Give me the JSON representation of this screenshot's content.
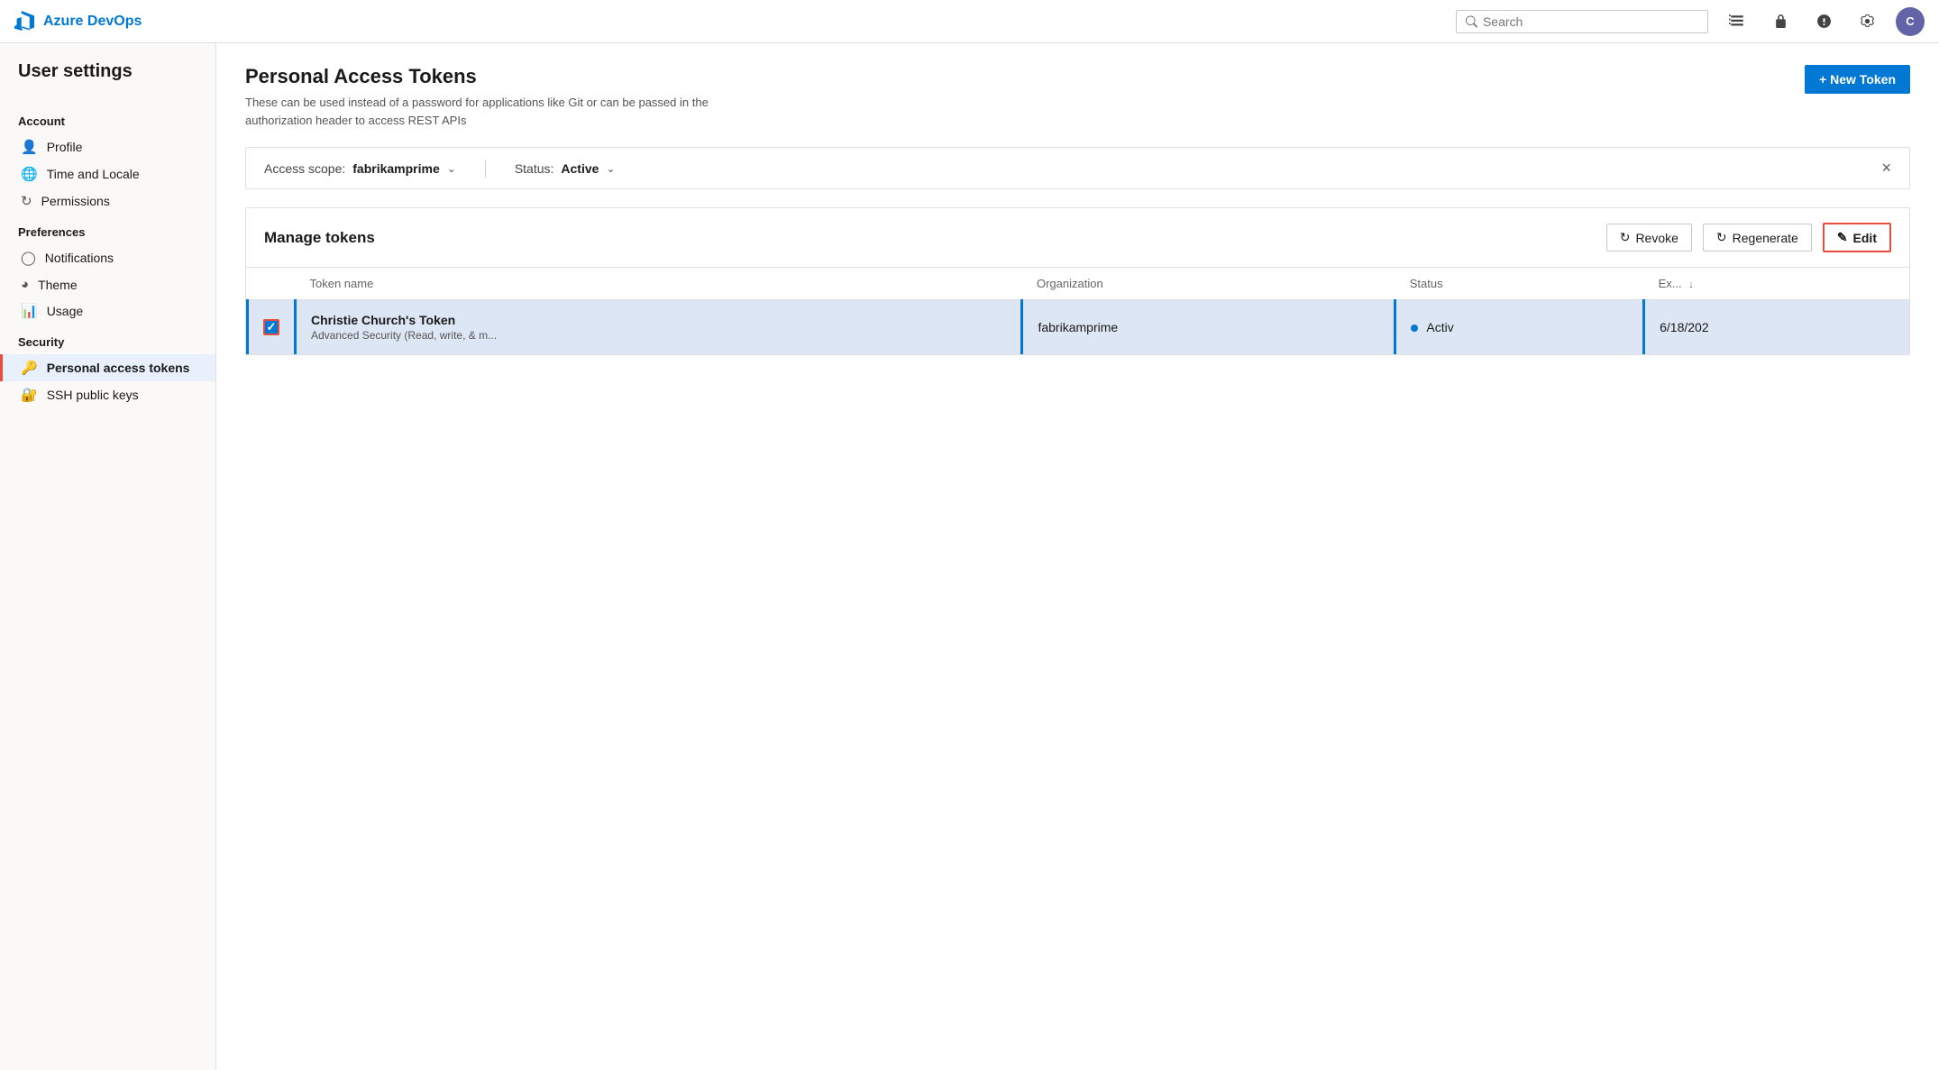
{
  "app": {
    "name": "Azure DevOps",
    "logo_color": "#0078d4"
  },
  "nav": {
    "search_placeholder": "Search",
    "icons": [
      "list-icon",
      "lock-icon",
      "help-icon",
      "settings-icon"
    ],
    "avatar_initials": "C"
  },
  "sidebar": {
    "title": "User settings",
    "sections": [
      {
        "label": "Account",
        "items": [
          {
            "id": "profile",
            "label": "Profile",
            "icon": "👤"
          },
          {
            "id": "time-locale",
            "label": "Time and Locale",
            "icon": "🌐"
          },
          {
            "id": "permissions",
            "label": "Permissions",
            "icon": "🔄"
          }
        ]
      },
      {
        "label": "Preferences",
        "items": [
          {
            "id": "notifications",
            "label": "Notifications",
            "icon": "🔔"
          },
          {
            "id": "theme",
            "label": "Theme",
            "icon": "🎨"
          },
          {
            "id": "usage",
            "label": "Usage",
            "icon": "📊"
          }
        ]
      },
      {
        "label": "Security",
        "items": [
          {
            "id": "personal-access-tokens",
            "label": "Personal access tokens",
            "icon": "🔑",
            "active": true
          },
          {
            "id": "ssh-public-keys",
            "label": "SSH public keys",
            "icon": "🔒"
          }
        ]
      }
    ]
  },
  "main": {
    "page_title": "Personal Access Tokens",
    "page_description": "These can be used instead of a password for applications like Git or can be passed in the authorization header to access REST APIs",
    "new_token_label": "+ New Token",
    "filter_bar": {
      "scope_label": "Access scope:",
      "scope_value": "fabrikamprime",
      "status_label": "Status:",
      "status_value": "Active",
      "close_label": "×"
    },
    "manage_section": {
      "title": "Manage tokens",
      "revoke_label": "Revoke",
      "regenerate_label": "Regenerate",
      "edit_label": "Edit",
      "table": {
        "columns": [
          {
            "id": "checkbox",
            "label": ""
          },
          {
            "id": "token-name",
            "label": "Token name"
          },
          {
            "id": "organization",
            "label": "Organization"
          },
          {
            "id": "status",
            "label": "Status"
          },
          {
            "id": "expiry",
            "label": "Ex..."
          }
        ],
        "rows": [
          {
            "id": "row1",
            "name": "Christie Church's Token",
            "description": "Advanced Security (Read, write, & m...",
            "organization": "fabrikamprime",
            "status": "Activ",
            "expiry": "6/18/202",
            "selected": true
          }
        ]
      }
    }
  }
}
